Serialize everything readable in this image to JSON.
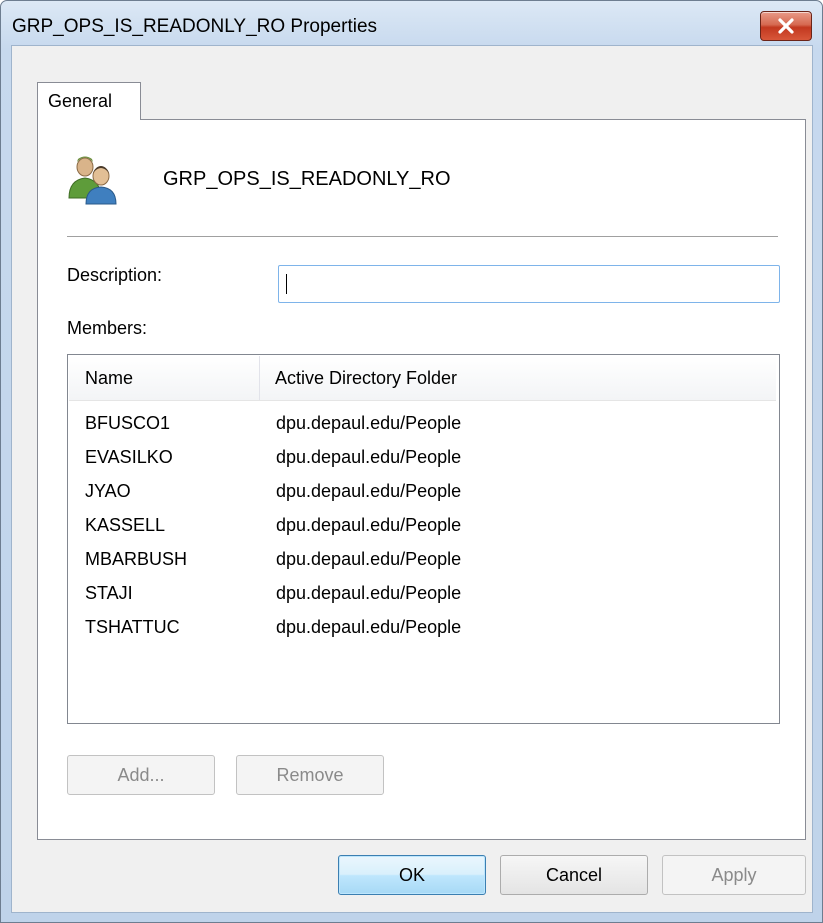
{
  "window": {
    "title": "GRP_OPS_IS_READONLY_RO Properties",
    "close_icon": "close-icon",
    "colors": {
      "frame": "#c7d9ee",
      "close": "#c2381f"
    }
  },
  "tabs": [
    {
      "label": "General",
      "selected": true
    }
  ],
  "general": {
    "group_icon": "group-users-icon",
    "group_name": "GRP_OPS_IS_READONLY_RO",
    "description_label": "Description:",
    "description_value": "",
    "members_label": "Members:",
    "columns": {
      "name": "Name",
      "folder": "Active Directory Folder"
    },
    "members": [
      {
        "name": "BFUSCO1",
        "folder": "dpu.depaul.edu/People"
      },
      {
        "name": "EVASILKO",
        "folder": "dpu.depaul.edu/People"
      },
      {
        "name": "JYAO",
        "folder": "dpu.depaul.edu/People"
      },
      {
        "name": "KASSELL",
        "folder": "dpu.depaul.edu/People"
      },
      {
        "name": "MBARBUSH",
        "folder": "dpu.depaul.edu/People"
      },
      {
        "name": "STAJI",
        "folder": "dpu.depaul.edu/People"
      },
      {
        "name": "TSHATTUC",
        "folder": "dpu.depaul.edu/People"
      }
    ],
    "add_label": "Add...",
    "remove_label": "Remove"
  },
  "footer": {
    "ok_label": "OK",
    "cancel_label": "Cancel",
    "apply_label": "Apply"
  }
}
